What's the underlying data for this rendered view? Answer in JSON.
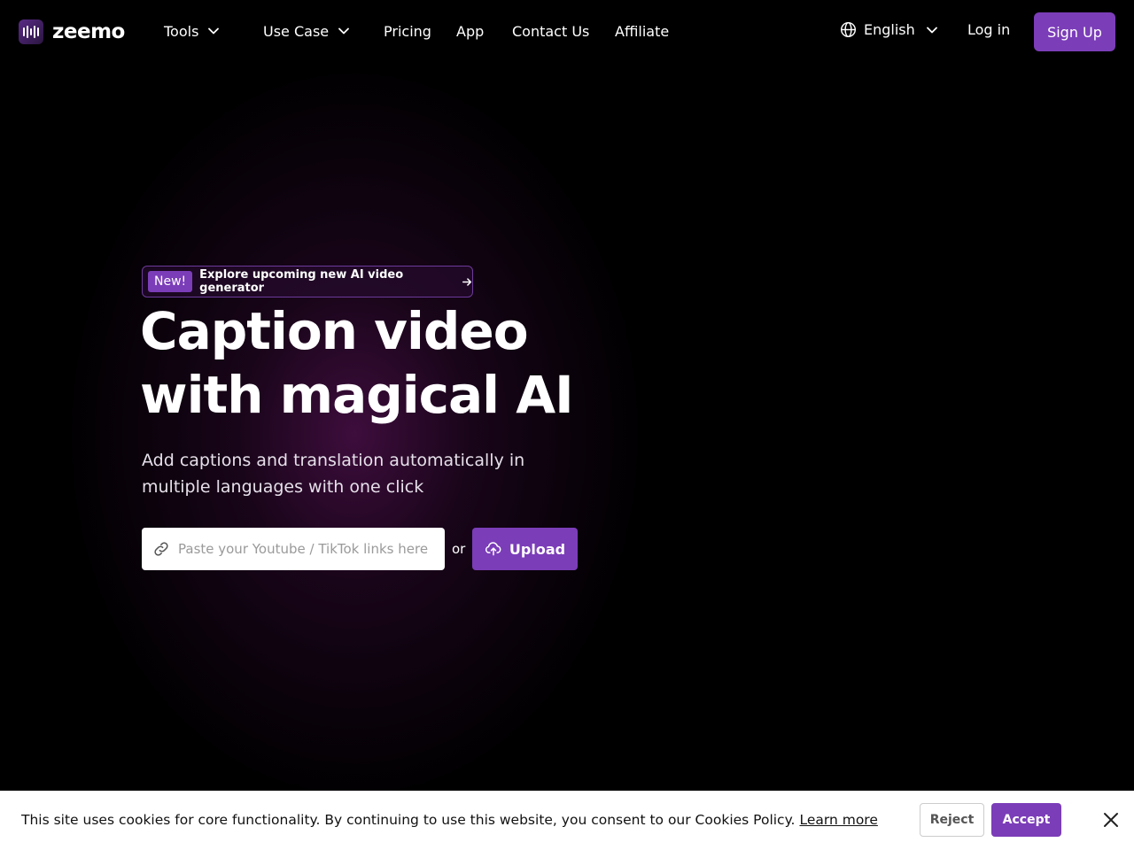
{
  "brand": {
    "name": "zeemo",
    "accent": "#7b3db8"
  },
  "nav": {
    "items": [
      {
        "label": "Tools",
        "has_dropdown": true
      },
      {
        "label": "Use Case",
        "has_dropdown": true
      },
      {
        "label": "Pricing",
        "has_dropdown": false
      },
      {
        "label": "App",
        "has_dropdown": false
      },
      {
        "label": "Contact Us",
        "has_dropdown": false
      },
      {
        "label": "Affiliate",
        "has_dropdown": false
      }
    ],
    "language": "English",
    "login": "Log in",
    "signup": "Sign Up"
  },
  "hero": {
    "badge_tag": "New!",
    "badge_text": "Explore upcoming new AI video generator",
    "headline_line1": "Caption video",
    "headline_line2": "with magical AI",
    "subhead": "Add captions and translation automatically in multiple languages with one click",
    "search_placeholder": "Paste your Youtube / TikTok links here",
    "or": "or",
    "upload": "Upload"
  },
  "cookie": {
    "message": "This site uses cookies for core functionality. By continuing to use this website, you consent to our Cookies Policy.",
    "learn_more": "Learn more",
    "reject": "Reject",
    "accept": "Accept"
  },
  "icons": {
    "logo": "waveform-logo-icon",
    "dropdown": "chevron-down-icon",
    "language": "globe-icon",
    "badge_arrow": "arrow-right-icon",
    "search": "link-icon",
    "upload": "cloud-upload-icon",
    "close": "close-icon"
  }
}
